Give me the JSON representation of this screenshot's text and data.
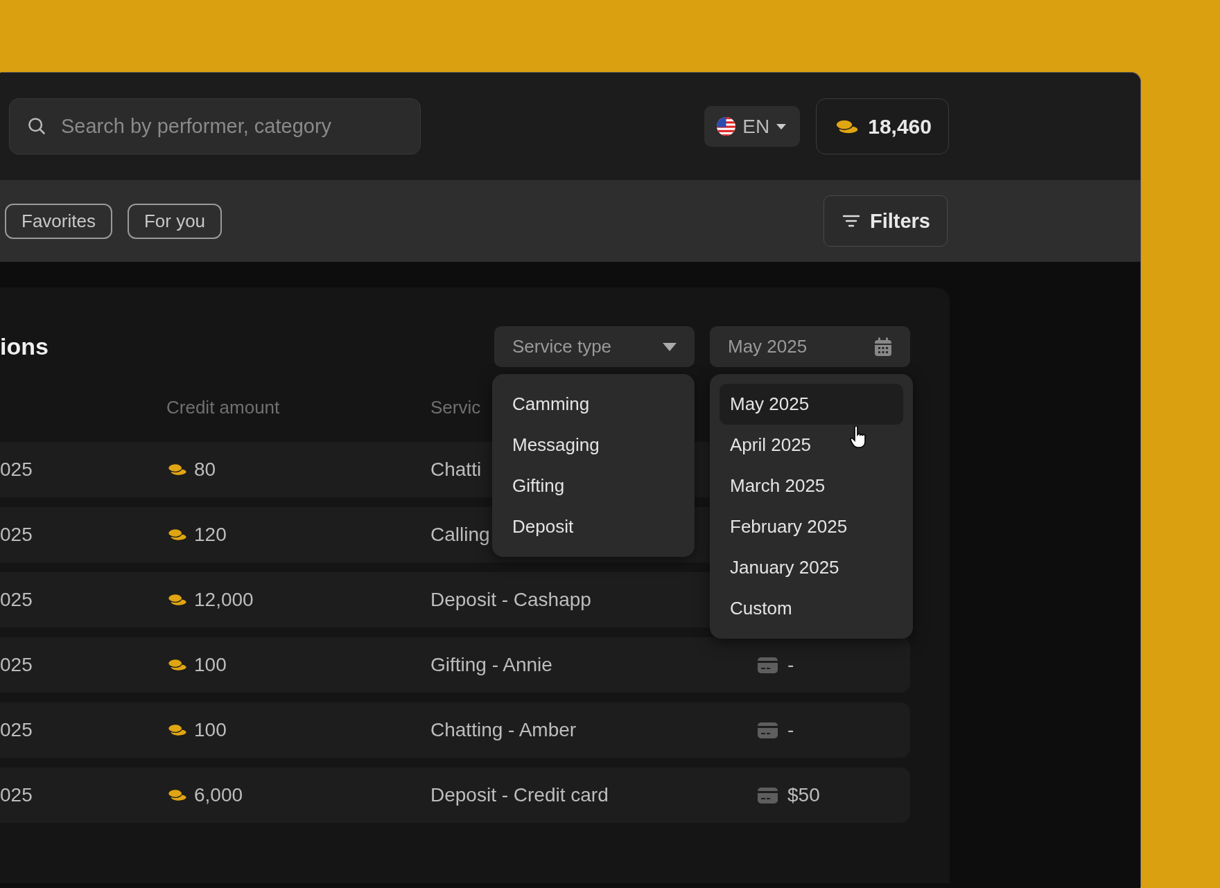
{
  "header": {
    "search": {
      "placeholder": "Search by performer, category"
    },
    "language": {
      "code": "EN"
    },
    "balance": "18,460"
  },
  "chips": [
    {
      "label": "Favorites",
      "selected": false
    },
    {
      "label": "For you",
      "selected": false
    }
  ],
  "filters_button": "Filters",
  "panel": {
    "title": "ions",
    "service_filter": {
      "placeholder": "Service type"
    },
    "date_filter": {
      "value": "May 2025"
    },
    "columns": [
      "Credit amount",
      "Servic"
    ],
    "rows": [
      {
        "column_1": "025",
        "credit": "80",
        "service": "Chatti"
      },
      {
        "column_1": "025",
        "credit": "120",
        "service": "Calling"
      },
      {
        "column_1": "025",
        "credit": "12,000",
        "service": "Deposit - Cashapp"
      },
      {
        "column_1": "025",
        "credit": "100",
        "service": "Gifting - Annie",
        "payment": "-"
      },
      {
        "column_1": "025",
        "credit": "100",
        "service": "Chatting - Amber",
        "payment": "-"
      },
      {
        "column_1": "025",
        "credit": "6,000",
        "service": "Deposit - Credit card",
        "payment": "$50"
      }
    ],
    "service_menu": [
      {
        "label": "Camming",
        "selected": false
      },
      {
        "label": "Messaging",
        "selected": false
      },
      {
        "label": "Gifting",
        "selected": false
      },
      {
        "label": "Deposit",
        "selected": false
      }
    ],
    "date_menu": [
      {
        "label": "May 2025",
        "selected": true
      },
      {
        "label": "April 2025",
        "selected": false
      },
      {
        "label": "March 2025",
        "selected": false
      },
      {
        "label": "February 2025",
        "selected": false
      },
      {
        "label": "January 2025",
        "selected": false
      },
      {
        "label": "Custom",
        "selected": false
      }
    ]
  }
}
